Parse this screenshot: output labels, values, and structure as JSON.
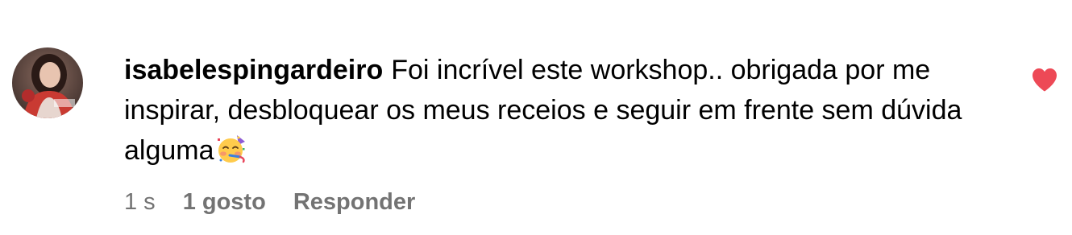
{
  "comment": {
    "username": "isabelespingardeiro",
    "text": "Foi incrível este workshop.. obrigada por me inspirar, desbloquear os meus receios e seguir em frente sem dúvida alguma",
    "emoji_icon": "partying-face-emoji",
    "avatar_icon": "profile-photo",
    "like_icon": "heart-filled-icon",
    "liked": true,
    "time": "1 s",
    "likes": "1 gosto",
    "reply_label": "Responder",
    "colors": {
      "heart": "#ed4956",
      "meta_text": "#737373"
    }
  }
}
